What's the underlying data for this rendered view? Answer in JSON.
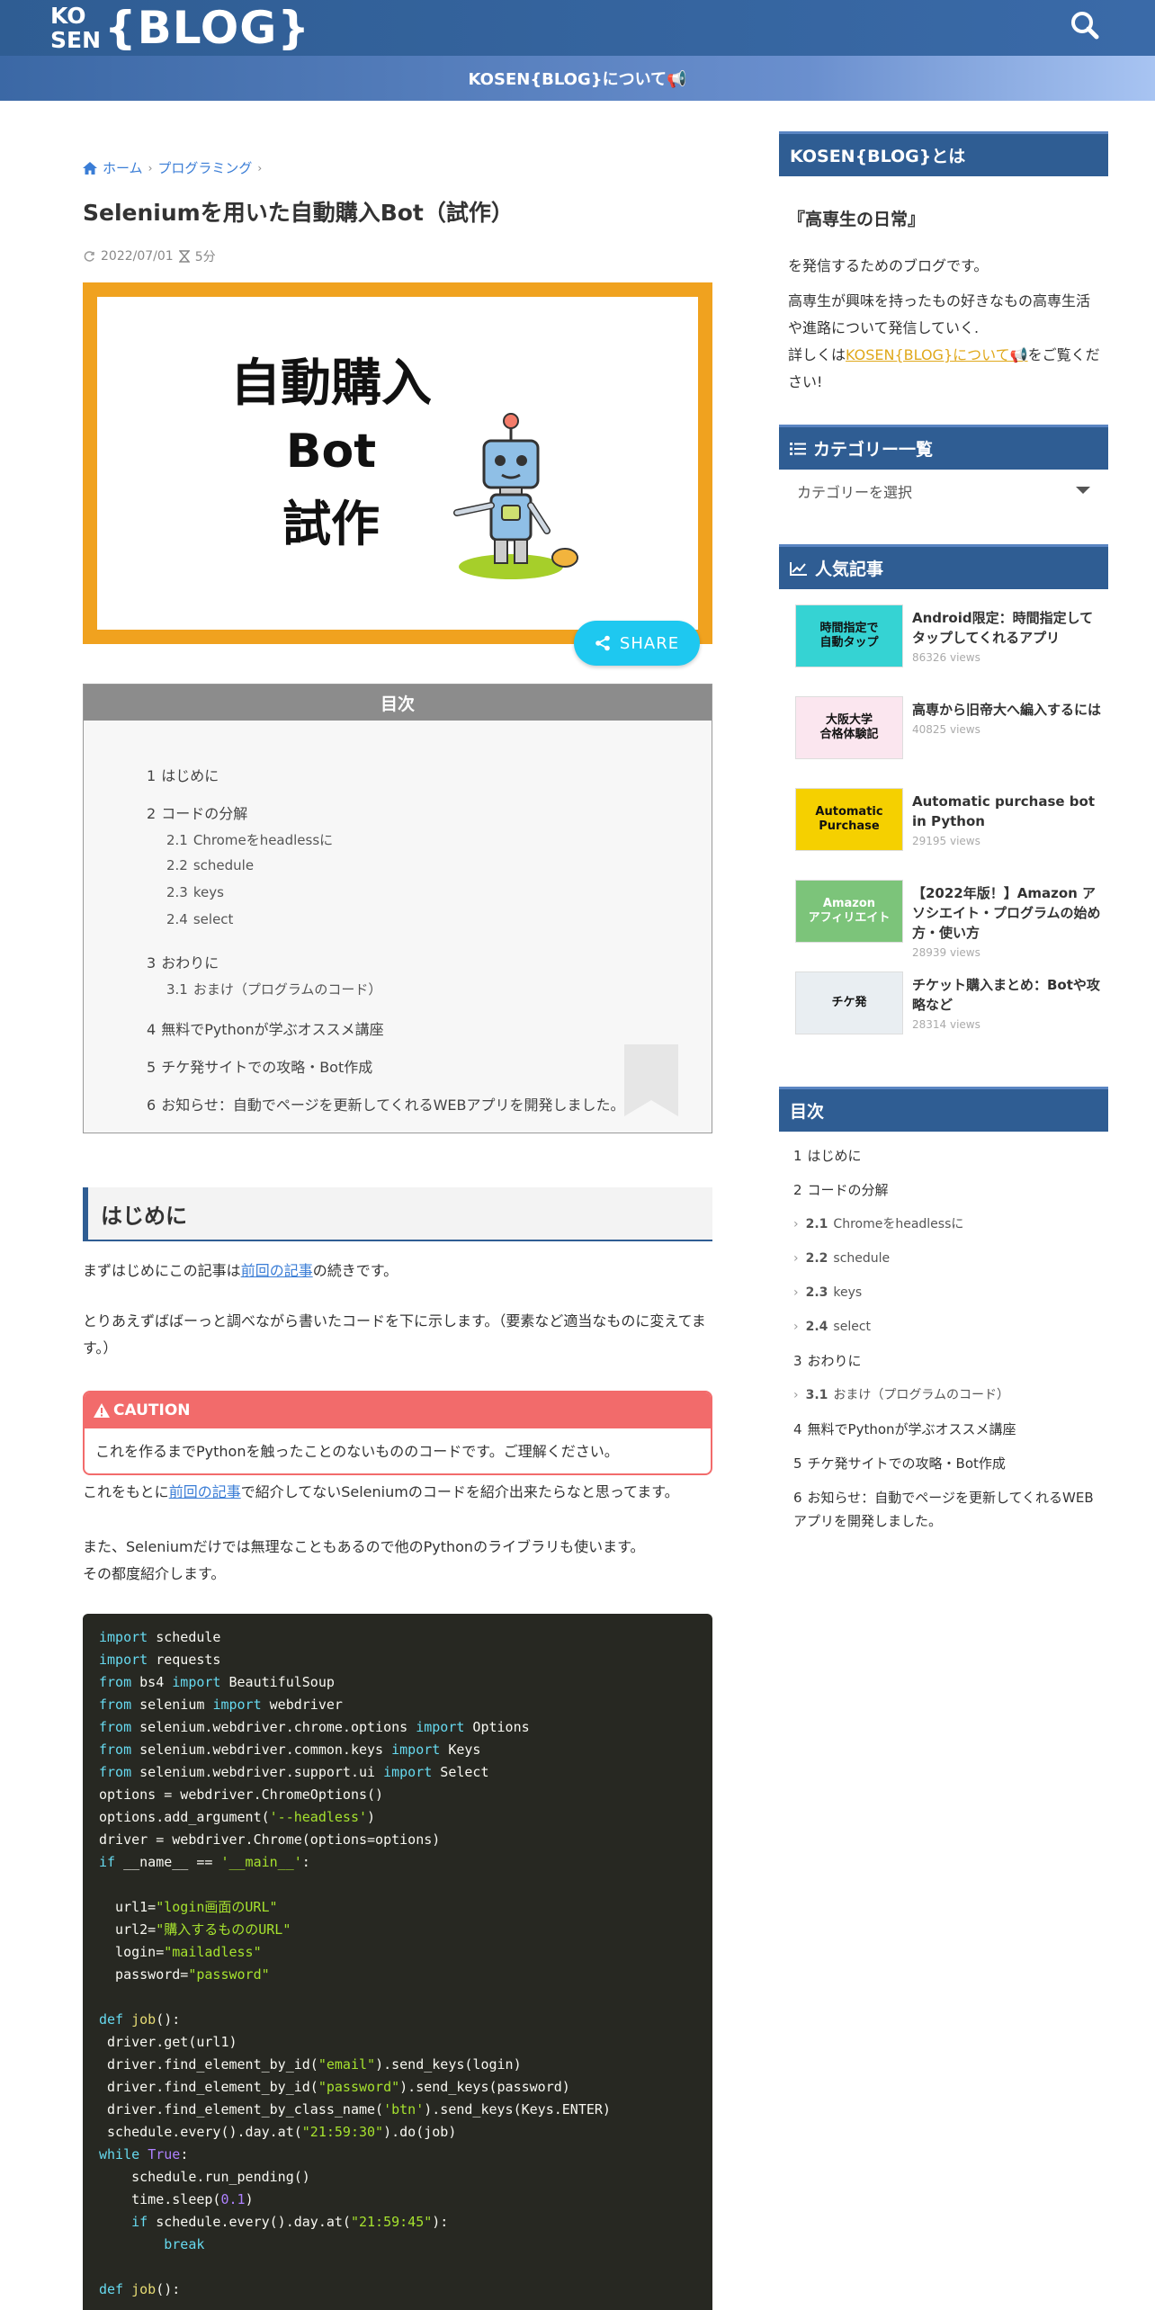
{
  "header": {
    "logo_top": "KO",
    "logo_bottom": "SEN",
    "logo_main": "{BLOG}",
    "nav_link": "KOSEN{BLOG}について📢"
  },
  "breadcrumb": {
    "home": "ホーム",
    "category": "プログラミング"
  },
  "article": {
    "title": "Seleniumを用いた自動購入Bot（試作）",
    "date": "2022/07/01",
    "read_time": "5分",
    "hero": {
      "line1": "自動購入",
      "line2": "Bot",
      "line3": "試作"
    },
    "share_label": "SHARE",
    "toc_title": "目次",
    "toc": [
      {
        "num": "1",
        "label": "はじめに",
        "sub": false
      },
      {
        "num": "2",
        "label": "コードの分解",
        "sub": false
      },
      {
        "num": "2.1",
        "label": "Chromeをheadlessに",
        "sub": true
      },
      {
        "num": "2.2",
        "label": "schedule",
        "sub": true
      },
      {
        "num": "2.3",
        "label": "keys",
        "sub": true
      },
      {
        "num": "2.4",
        "label": "select",
        "sub": true
      },
      {
        "num": "3",
        "label": "おわりに",
        "sub": false
      },
      {
        "num": "3.1",
        "label": "おまけ（プログラムのコード）",
        "sub": true
      },
      {
        "num": "4",
        "label": "無料でPythonが学ぶオススメ講座",
        "sub": false
      },
      {
        "num": "5",
        "label": "チケ発サイトでの攻略・Bot作成",
        "sub": false
      },
      {
        "num": "6",
        "label": "お知らせ：自動でページを更新してくれるWEBアプリを開発しました。",
        "sub": false
      }
    ],
    "h2_intro": "はじめに",
    "p1_before": "まずはじめにこの記事は",
    "p1_link": "前回の記事",
    "p1_after": "の続きです。",
    "p2": "とりあえずばばーっと調べながら書いたコードを下に示します。（要素など適当なものに変えてます。）",
    "caution_head": "CAUTION",
    "caution_body": "これを作るまでPythonを触ったことのないもののコードです。ご理解ください。",
    "p3_before": "これをもとに",
    "p3_link": "前回の記事",
    "p3_after": "で紹介してないSeleniumのコードを紹介出来たらなと思ってます。",
    "p4_line1": "また、Seleniumだけでは無理なこともあるので他のPythonのライブラリも使います。",
    "p4_line2": "その都度紹介します。"
  },
  "sidebar": {
    "about_head": "KOSEN{BLOG}とは",
    "about_title": "『高専生の日常』",
    "about_p1": "を発信するためのブログです。",
    "about_p2": "高専生が興味を持ったもの好きなもの高専生活や進路について発信していく.",
    "about_p3_before": "詳しくは",
    "about_p3_link": "KOSEN{BLOG}について📢",
    "about_p3_after": "をご覧ください!",
    "cat_head": "カテゴリー一覧",
    "cat_select": "カテゴリーを選択",
    "pop_head": "人気記事",
    "popular": [
      {
        "title": "Android限定：時間指定してタップしてくれるアプリ",
        "views": "86326 views",
        "thumb_text": "時間指定で\n自動タップ"
      },
      {
        "title": "高専から旧帝大へ編入するには",
        "views": "40825 views",
        "thumb_text": "大阪大学\n合格体験記"
      },
      {
        "title": "Automatic purchase bot in Python",
        "views": "29195 views",
        "thumb_text": "Automatic\nPurchase"
      },
      {
        "title": "【2022年版！】Amazon アソシエイト・プログラムの始め方・使い方",
        "views": "28939 views",
        "thumb_text": "Amazon\nアフィリエイト"
      },
      {
        "title": "チケット購入まとめ：Botや攻略など",
        "views": "28314 views",
        "thumb_text": "チケ発"
      }
    ],
    "toc_head": "目次",
    "toc": [
      {
        "num": "1",
        "label": "はじめに",
        "sub": false
      },
      {
        "num": "2",
        "label": "コードの分解",
        "sub": false
      },
      {
        "num": "2.1",
        "label": "Chromeをheadlessに",
        "sub": true
      },
      {
        "num": "2.2",
        "label": "schedule",
        "sub": true
      },
      {
        "num": "2.3",
        "label": "keys",
        "sub": true
      },
      {
        "num": "2.4",
        "label": "select",
        "sub": true
      },
      {
        "num": "3",
        "label": "おわりに",
        "sub": false
      },
      {
        "num": "3.1",
        "label": "おまけ（プログラムのコード）",
        "sub": true
      },
      {
        "num": "4",
        "label": "無料でPythonが学ぶオススメ講座",
        "sub": false
      },
      {
        "num": "5",
        "label": "チケ発サイトでの攻略・Bot作成",
        "sub": false
      },
      {
        "num": "6",
        "label": "お知らせ：自動でページを更新してくれるWEBアプリを開発しました。",
        "sub": false
      }
    ]
  },
  "code_lines": [
    "import schedule",
    "import requests",
    "from bs4 import BeautifulSoup",
    "from selenium import webdriver",
    "from selenium.webdriver.chrome.options import Options",
    "from selenium.webdriver.common.keys import Keys",
    "from selenium.webdriver.support.ui import Select",
    "options = webdriver.ChromeOptions()",
    "options.add_argument('--headless')",
    "driver = webdriver.Chrome(options=options)",
    "if __name__ == '__main__':",
    "",
    "  url1=\"login画面のURL\"",
    "  url2=\"購入するもののURL\"",
    "  login=\"mailadless\"",
    "  password=\"password\"",
    "",
    "def job():",
    " driver.get(url1)",
    " driver.find_element_by_id(\"email\").send_keys(login)",
    " driver.find_element_by_id(\"password\").send_keys(password)",
    " driver.find_element_by_class_name('btn').send_keys(Keys.ENTER)",
    " schedule.every().day.at(\"21:59:30\").do(job)",
    "while True:",
    "    schedule.run_pending()",
    "    time.sleep(0.1)",
    "    if schedule.every().day.at(\"21:59:45\"):",
    "        break",
    "",
    "def job():"
  ],
  "colors": {
    "brand": "#2f5d93",
    "hero_frame": "#f0a21f",
    "share": "#1ec8f0",
    "caution": "#f26b6b",
    "code_bg": "#272822"
  }
}
